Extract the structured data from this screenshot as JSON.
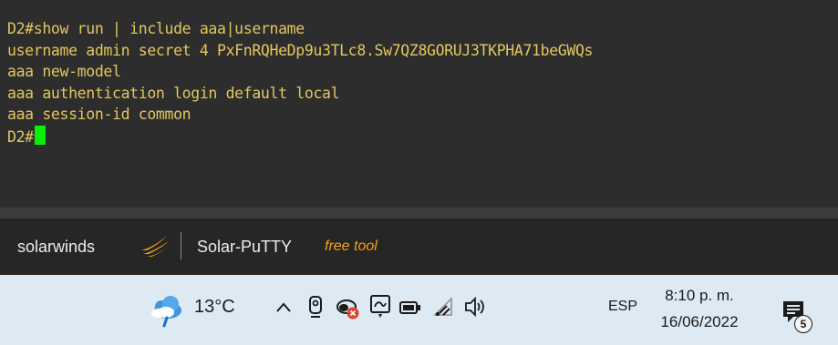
{
  "terminal": {
    "lines": [
      "D2#show run | include aaa|username",
      "username admin secret 4 PxFnRQHeDp9u3TLc8.Sw7QZ8GORUJ3TKPHA71beGWQs",
      "aaa new-model",
      "aaa authentication login default local",
      "aaa session-id common"
    ],
    "prompt": "D2#",
    "text_color": "#e2c75e",
    "cursor_color": "#0bf00b"
  },
  "footer": {
    "brand": "solarwinds",
    "product": "Solar-PuTTY",
    "tag": "free tool",
    "tag_color": "#f6a21b"
  },
  "taskbar": {
    "weather": {
      "temperature": "13°C",
      "icon": "cloud-rain-icon"
    },
    "tray_icons": [
      "chevron-up-icon",
      "webcam-icon",
      "network-error-icon",
      "ink-workspace-icon",
      "battery-icon",
      "wifi-icon",
      "volume-icon"
    ],
    "language": "ESP",
    "time": "8:10 p. m.",
    "date": "16/06/2022",
    "notifications": {
      "icon": "notification-icon",
      "count": "5"
    }
  }
}
